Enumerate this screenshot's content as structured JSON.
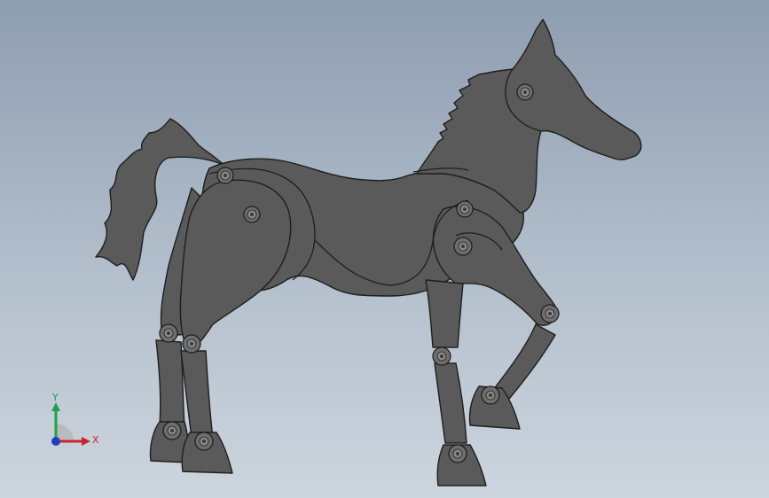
{
  "viewport": {
    "background_top": "#8e9db0",
    "background_bottom": "#cdd5de",
    "part_color": "#5a5a5a",
    "edge_color": "#1e1e1e"
  },
  "model": {
    "icon": "horse-assembly-icon"
  },
  "triad": {
    "x_label": "X",
    "y_label": "Y",
    "x_color": "#c8242b",
    "y_color": "#1fa24a",
    "z_color": "#1d3fbf"
  }
}
